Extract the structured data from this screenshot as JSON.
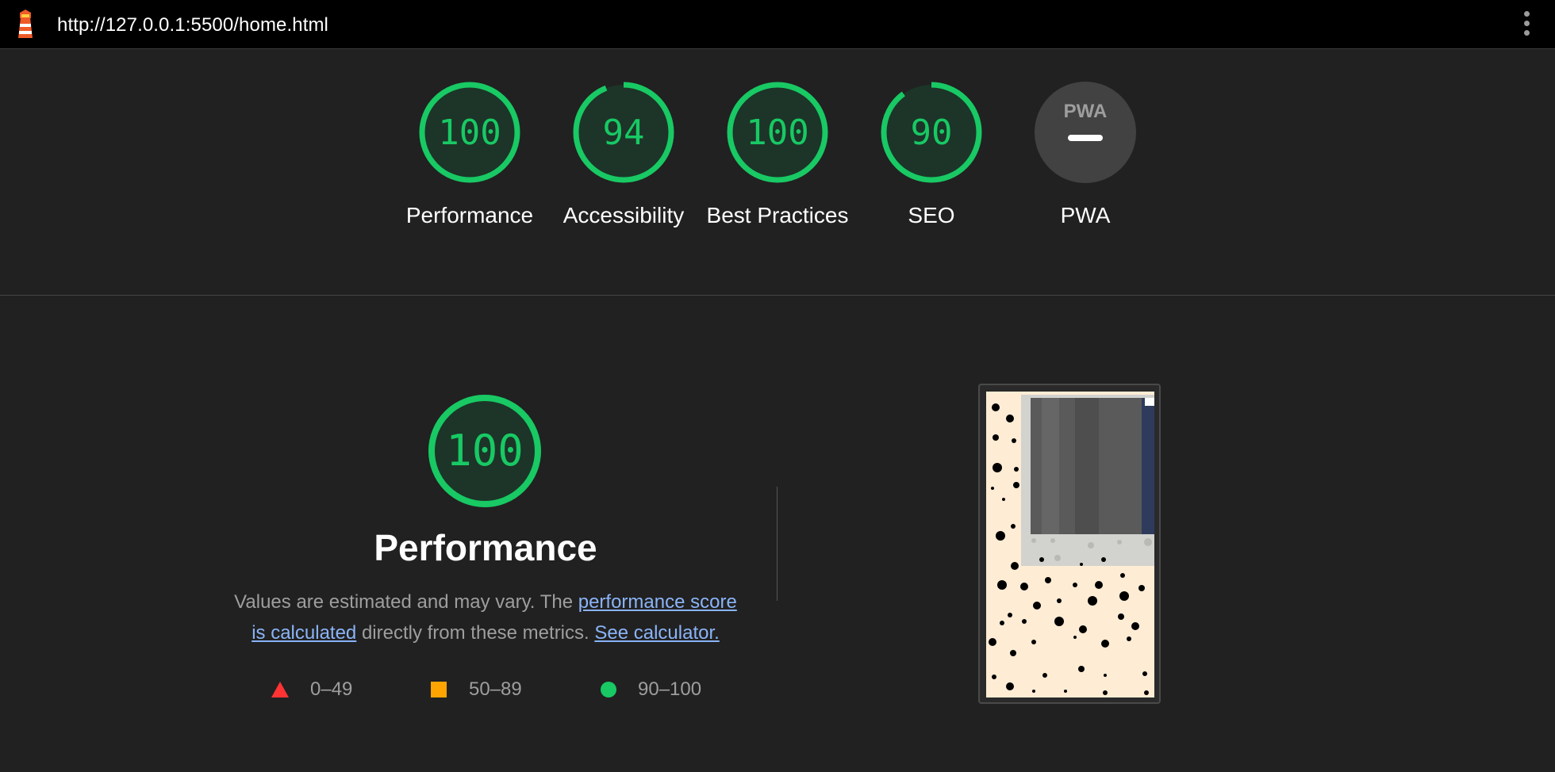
{
  "browser": {
    "url": "http://127.0.0.1:5500/home.html",
    "logo_icon": "lighthouse-icon",
    "menu_icon": "kebab-menu-icon"
  },
  "categories": [
    {
      "id": "performance",
      "score": "100",
      "score_value": 100,
      "label": "Performance"
    },
    {
      "id": "accessibility",
      "score": "94",
      "score_value": 94,
      "label": "Accessibility"
    },
    {
      "id": "best-practices",
      "score": "100",
      "score_value": 100,
      "label": "Best Practices"
    },
    {
      "id": "seo",
      "score": "90",
      "score_value": 90,
      "label": "SEO"
    },
    {
      "id": "pwa",
      "score": "",
      "label": "PWA",
      "badge": "PWA"
    }
  ],
  "performance": {
    "score": "100",
    "score_value": 100,
    "title": "Performance",
    "desc_prefix": "Values are estimated and may vary. The ",
    "link_score": "performance score is calculated",
    "desc_middle": " directly from these metrics. ",
    "link_calculator": "See calculator."
  },
  "legend": [
    {
      "shape": "triangle",
      "range": "0–49",
      "color": "#ff3333"
    },
    {
      "shape": "square",
      "range": "50–89",
      "color": "#ffa400"
    },
    {
      "shape": "circle",
      "range": "90–100",
      "color": "#18c964"
    }
  ],
  "colors": {
    "pass": "#18c964",
    "background": "#212121",
    "link": "#8ab4f8"
  }
}
